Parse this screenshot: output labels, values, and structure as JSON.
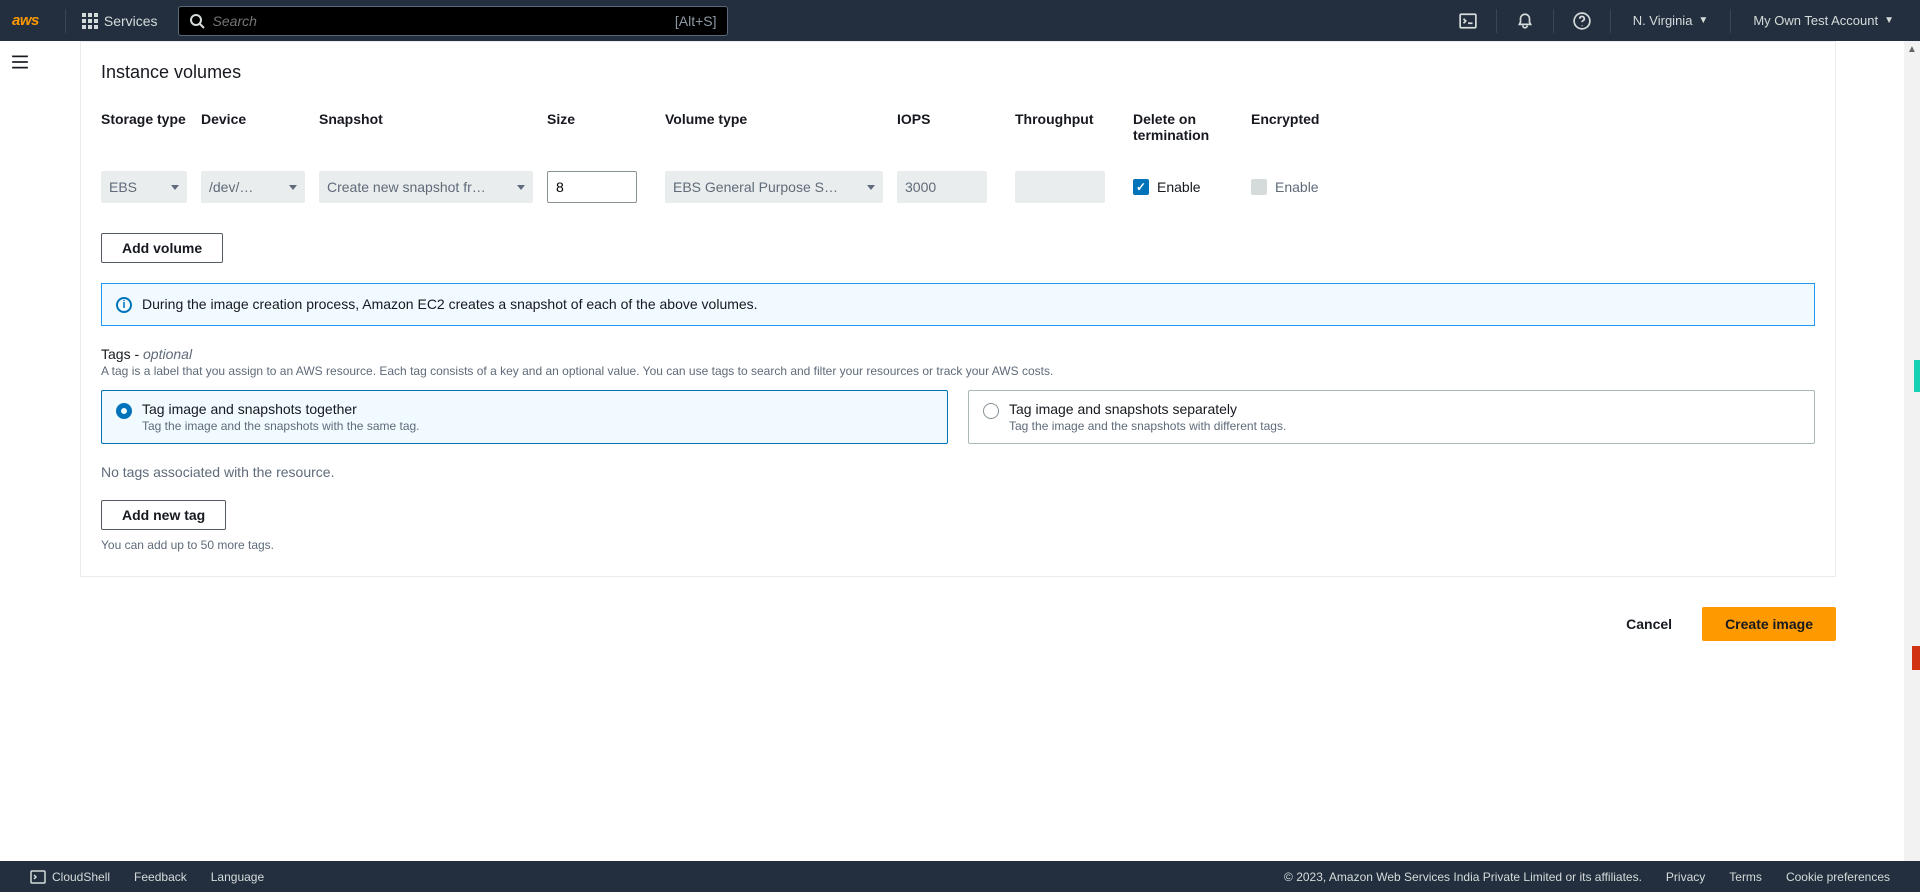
{
  "topnav": {
    "services_label": "Services",
    "search_placeholder": "Search",
    "search_kbd": "[Alt+S]",
    "region": "N. Virginia",
    "account": "My Own Test Account"
  },
  "section": {
    "title": "Instance volumes"
  },
  "volumes": {
    "headers": {
      "storage_type": "Storage type",
      "device": "Device",
      "snapshot": "Snapshot",
      "size": "Size",
      "volume_type": "Volume type",
      "iops": "IOPS",
      "throughput": "Throughput",
      "delete_on_termination": "Delete on termination",
      "encrypted": "Encrypted"
    },
    "row": {
      "storage_type": "EBS",
      "device": "/dev/…",
      "snapshot": "Create new snapshot fr…",
      "size": "8",
      "volume_type": "EBS General Purpose S…",
      "iops": "3000",
      "throughput": "",
      "delete_label": "Enable",
      "encrypted_label": "Enable"
    },
    "add_button": "Add volume",
    "banner": "During the image creation process, Amazon EC2 creates a snapshot of each of the above volumes."
  },
  "tags": {
    "heading": "Tags - ",
    "optional": "optional",
    "description": "A tag is a label that you assign to an AWS resource. Each tag consists of a key and an optional value. You can use tags to search and filter your resources or track your AWS costs.",
    "opt_together_title": "Tag image and snapshots together",
    "opt_together_sub": "Tag the image and the snapshots with the same tag.",
    "opt_separate_title": "Tag image and snapshots separately",
    "opt_separate_sub": "Tag the image and the snapshots with different tags.",
    "no_tags": "No tags associated with the resource.",
    "add_tag_button": "Add new tag",
    "tag_limit": "You can add up to 50 more tags."
  },
  "actions": {
    "cancel": "Cancel",
    "create": "Create image"
  },
  "footer": {
    "cloudshell": "CloudShell",
    "feedback": "Feedback",
    "language": "Language",
    "copyright": "© 2023, Amazon Web Services India Private Limited or its affiliates.",
    "privacy": "Privacy",
    "terms": "Terms",
    "cookies": "Cookie preferences"
  }
}
